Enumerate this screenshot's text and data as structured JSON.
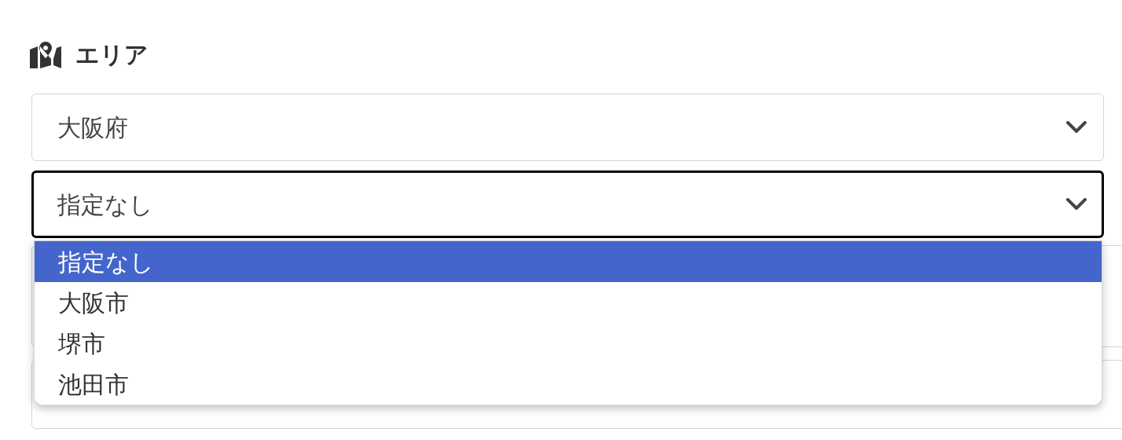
{
  "section": {
    "title": "エリア"
  },
  "selects": [
    {
      "value": "大阪府",
      "focused": false
    },
    {
      "value": "指定なし",
      "focused": true
    }
  ],
  "dropdown": {
    "options": [
      {
        "label": "指定なし",
        "selected": true
      },
      {
        "label": "大阪市",
        "selected": false
      },
      {
        "label": "堺市",
        "selected": false
      },
      {
        "label": "池田市",
        "selected": false
      }
    ]
  }
}
